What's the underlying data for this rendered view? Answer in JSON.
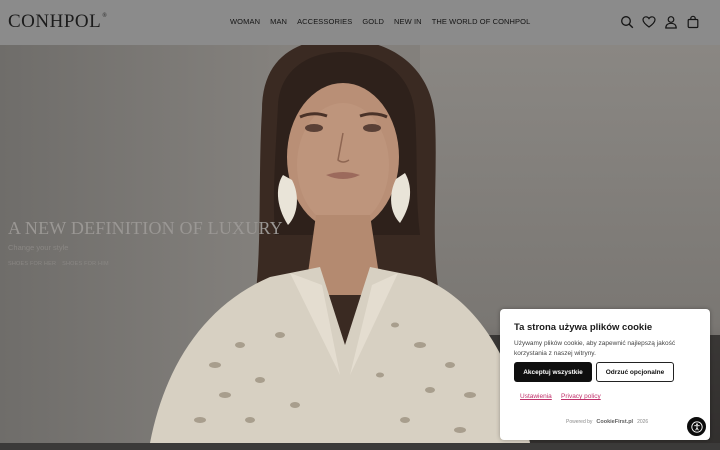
{
  "header": {
    "logo": "CONHPOL",
    "logo_mark": "®",
    "nav": [
      "WOMAN",
      "MAN",
      "ACCESSORIES",
      "GOLD",
      "NEW IN",
      "THE WORLD OF CONHPOL"
    ],
    "icons": [
      "search-icon",
      "heart-icon",
      "user-icon",
      "bag-icon"
    ]
  },
  "hero": {
    "title": "A NEW DEFINITION OF LUXURY",
    "subtitle": "Change your style",
    "links": [
      "SHOES FOR HER",
      "SHOES FOR HIM"
    ]
  },
  "cookie": {
    "title": "Ta strona używa plików cookie",
    "text": "Używamy plików cookie, aby zapewnić najlepszą jakość korzystania z naszej witryny.",
    "accept": "Akceptuj wszystkie",
    "reject": "Odrzuć opcjonalne",
    "settings": "Ustawienia",
    "privacy": "Privacy policy",
    "powered_by": "Powered by",
    "brand": "CookieFirst.pl",
    "year": "2026"
  },
  "colors": {
    "overlay": "#8b8b8b",
    "link_accent": "#c0306a",
    "button_dark": "#0f0f0f"
  }
}
